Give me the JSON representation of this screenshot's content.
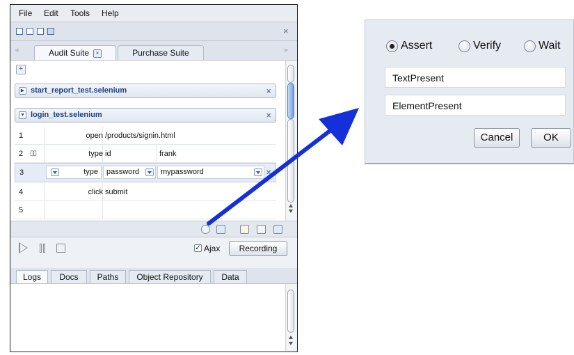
{
  "menu": [
    "File",
    "Edit",
    "Tools",
    "Help"
  ],
  "suite_tabs": [
    {
      "label": "Audit Suite",
      "active": true
    },
    {
      "label": "Purchase Suite",
      "active": false
    }
  ],
  "icons": {
    "close": "×",
    "plus": "+",
    "collapse": "▶",
    "expand": "▼",
    "tab_close": "×",
    "check": "✓"
  },
  "tests": [
    {
      "name": "start_report_test.selenium",
      "expanded": false
    },
    {
      "name": "login_test.selenium",
      "expanded": true
    }
  ],
  "steps": [
    {
      "num": "1",
      "command": "open",
      "target": "/products/signin.html",
      "value": ""
    },
    {
      "num": "2",
      "command": "type",
      "target": "id",
      "value": "frank"
    },
    {
      "num": "3",
      "command": "type",
      "target": "password",
      "value": "mypassword"
    },
    {
      "num": "4",
      "command": "click",
      "target": "submit",
      "value": ""
    },
    {
      "num": "5",
      "command": "",
      "target": "",
      "value": ""
    }
  ],
  "controls": {
    "ajax_label": "Ajax",
    "ajax_checked": true,
    "recording_label": "Recording"
  },
  "log_tabs": [
    {
      "label": "Logs",
      "active": true
    },
    {
      "label": "Docs",
      "active": false
    },
    {
      "label": "Paths",
      "active": false
    },
    {
      "label": "Object Repository",
      "active": false
    },
    {
      "label": "Data",
      "active": false
    }
  ],
  "dialog": {
    "modes": [
      {
        "label": "Assert",
        "selected": true
      },
      {
        "label": "Verify",
        "selected": false
      },
      {
        "label": "Wait",
        "selected": false
      }
    ],
    "options": [
      "TextPresent",
      "ElementPresent"
    ],
    "cancel": "Cancel",
    "ok": "OK"
  },
  "colors": {
    "arrow": "#1530d8",
    "test_name": "#1f3f7f",
    "accent": "#4f7ecb"
  }
}
